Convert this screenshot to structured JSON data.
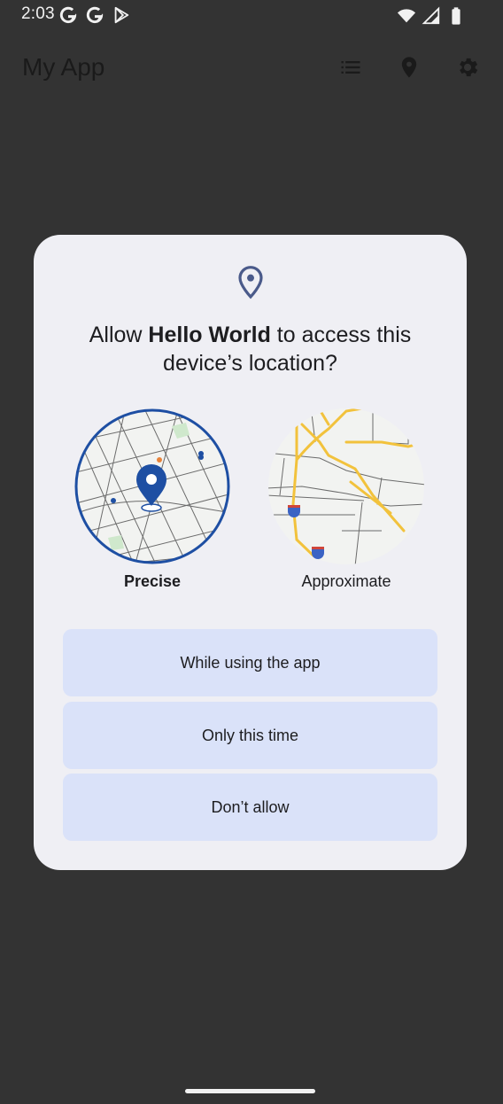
{
  "status_bar": {
    "time": "2:03",
    "left_icons": [
      "google-icon",
      "google-icon",
      "play-store-icon"
    ],
    "right_icons": [
      "wifi-icon",
      "signal-icon",
      "battery-icon"
    ]
  },
  "app_bar": {
    "title": "My App",
    "actions": [
      "list-icon",
      "location-pin-icon",
      "settings-gear-icon"
    ]
  },
  "dialog": {
    "title_prefix": "Allow ",
    "app_name": "Hello World",
    "title_suffix": " to access this device’s location?",
    "options": {
      "precise": {
        "label": "Precise",
        "selected": true
      },
      "approximate": {
        "label": "Approximate",
        "selected": false
      }
    },
    "buttons": {
      "while_using": "While using the app",
      "only_this_time": "Only this time",
      "dont_allow": "Don’t allow"
    }
  },
  "colors": {
    "background": "#333333",
    "dialog": "#efeff4",
    "button": "#dae2f9",
    "accent": "#1e4fa3",
    "road_major": "#f2c23c"
  }
}
